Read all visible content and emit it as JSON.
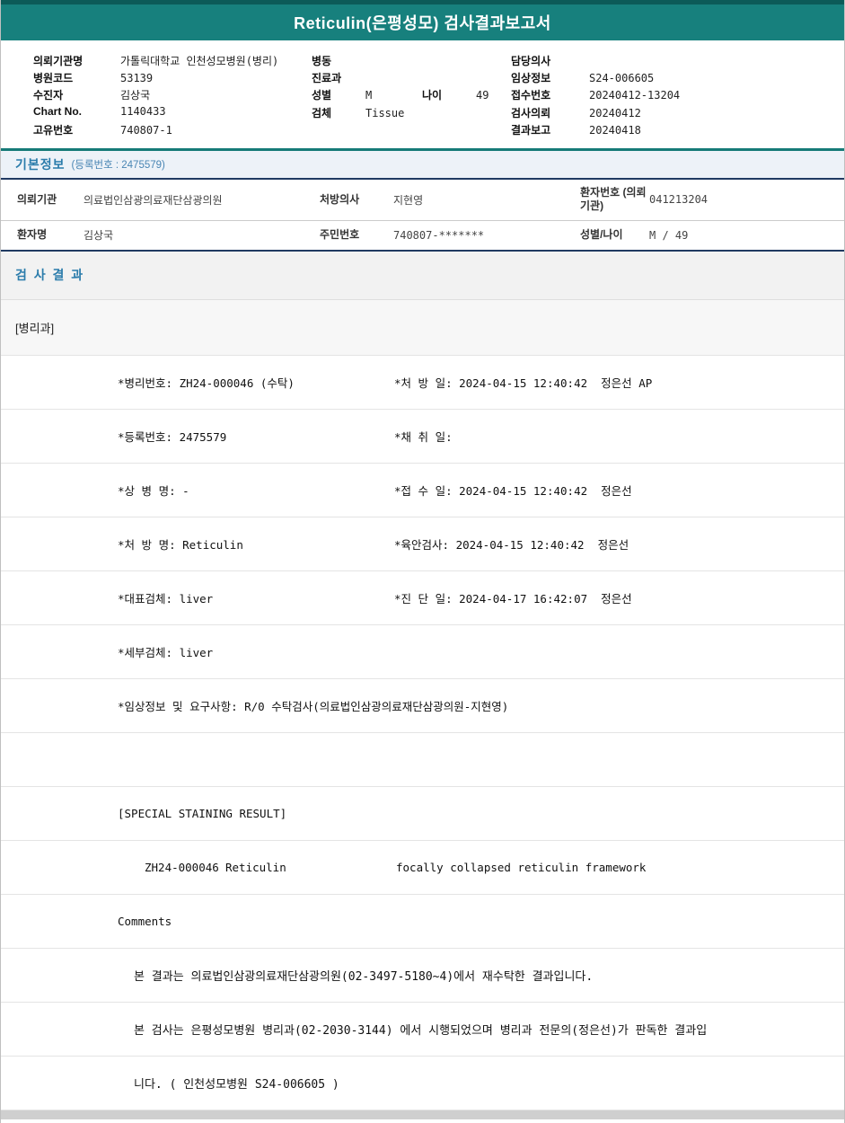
{
  "title": "Reticulin(은평성모) 검사결과보고서",
  "colors": {
    "header_teal": "#17807d",
    "header_teal_dark": "#0c5a58",
    "section_title_blue": "#2b7cab",
    "navy_border": "#203a62"
  },
  "patient_header": {
    "left": [
      {
        "label": "의뢰기관명",
        "value": "가톨릭대학교 인천성모병원(병리)"
      },
      {
        "label": "병원코드",
        "value": "53139"
      },
      {
        "label": "수진자",
        "value": "김상국"
      },
      {
        "label": "Chart No.",
        "value": "1140433"
      },
      {
        "label": "고유번호",
        "value": "740807-1"
      }
    ],
    "middle": {
      "ward_label": "병동",
      "ward_value": "",
      "dept_label": "진료과",
      "dept_value": "",
      "sex_label": "성별",
      "sex_value": "M",
      "age_label": "나이",
      "age_value": "49",
      "specimen_label": "검체",
      "specimen_value": "Tissue"
    },
    "right": [
      {
        "label": "담당의사",
        "value": ""
      },
      {
        "label": "임상정보",
        "value": "S24-006605"
      },
      {
        "label": "접수번호",
        "value": "20240412-13204"
      },
      {
        "label": "검사의뢰",
        "value": "20240412"
      },
      {
        "label": "결과보고",
        "value": "20240418"
      }
    ]
  },
  "basic_info": {
    "section_title": "기본정보",
    "section_sub": "(등록번호 : 2475579)",
    "row1": {
      "c1_label": "의뢰기관",
      "c1_value": "의료법인삼광의료재단삼광의원",
      "c2_label": "처방의사",
      "c2_value": "지현영",
      "c3_label": "환자번호 (의뢰기관)",
      "c3_value": "041213204"
    },
    "row2": {
      "c1_label": "환자명",
      "c1_value": "김상국",
      "c2_label": "주민번호",
      "c2_value": "740807-*******",
      "c3_label": "성별/나이",
      "c3_value": "M / 49"
    }
  },
  "results": {
    "section_title": "검 사 결 과",
    "department": "[병리과]",
    "detail_rows": [
      {
        "left": "*병리번호: ZH24-000046 (수탁)",
        "right": "*처 방 일: 2024-04-15 12:40:42  정은선 AP"
      },
      {
        "left": "*등록번호: 2475579",
        "right": "*채 취 일:"
      },
      {
        "left": "*상 병 명: -",
        "right": "*접 수 일: 2024-04-15 12:40:42  정은선"
      },
      {
        "left": "*처 방 명: Reticulin",
        "right": "*육안검사: 2024-04-15 12:40:42  정은선"
      },
      {
        "left": "*대표검체: liver",
        "right": "*진 단 일: 2024-04-17 16:42:07  정은선"
      },
      {
        "left": "*세부검체: liver",
        "right": ""
      },
      {
        "left": "*임상정보 및 요구사항: R/0 수탁검사(의료법인삼광의료재단삼광의원-지현영)",
        "right": ""
      }
    ],
    "staining_header": "[SPECIAL STAINING RESULT]",
    "staining_row": {
      "code": "ZH24-000046",
      "stain": "Reticulin",
      "result": "focally collapsed reticulin framework"
    },
    "comments_label": "Comments",
    "comment_lines": [
      "본 결과는 의료법인삼광의료재단삼광의원(02-3497-5180~4)에서 재수탁한 결과입니다.",
      "본 검사는 은평성모병원 병리과(02-2030-3144) 에서 시행되었으며 병리과 전문의(정은선)가 판독한 결과입",
      "니다. ( 인천성모병원 S24-006605 )"
    ]
  }
}
